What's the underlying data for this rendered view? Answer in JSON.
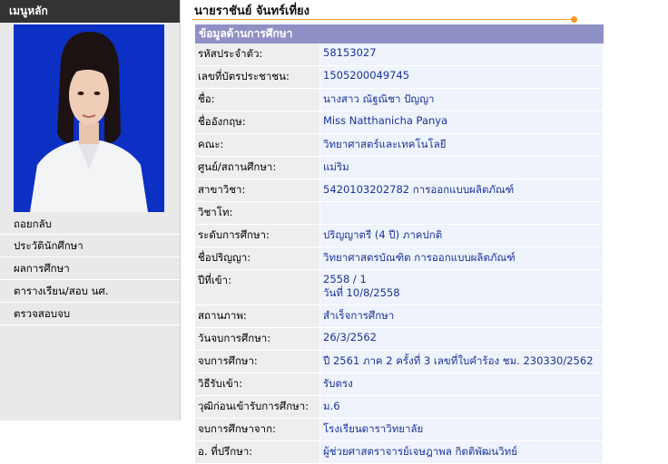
{
  "sidebar": {
    "header": "เมนูหลัก",
    "items": [
      {
        "label": "ถอยกลับ"
      },
      {
        "label": "ประวัตินักศึกษา"
      },
      {
        "label": "ผลการศึกษา"
      },
      {
        "label": "ตารางเรียน/สอบ นศ."
      },
      {
        "label": "ตรวจสอบจบ"
      }
    ]
  },
  "main": {
    "student_name": "นายราชันย์ จันทร์เที่ยง",
    "section_title": "ข้อมูลด้านการศึกษา",
    "rows": [
      {
        "label": "รหัสประจำตัว:",
        "value": "58153027"
      },
      {
        "label": "เลขที่บัตรประชาชน:",
        "value": "1505200049745"
      },
      {
        "label": "ชื่อ:",
        "value": "นางสาว ณัฐณิชา ปัญญา"
      },
      {
        "label": "ชื่ออังกฤษ:",
        "value": "Miss Natthanicha Panya"
      },
      {
        "label": "คณะ:",
        "value": "วิทยาศาสตร์และเทคโนโลยี"
      },
      {
        "label": "ศูนย์/สถานศึกษา:",
        "value": "แม่ริม"
      },
      {
        "label": "สาขาวิชา:",
        "value": "5420103202782 การออกแบบผลิตภัณฑ์"
      },
      {
        "label": "วิชาโท:",
        "value": ""
      },
      {
        "label": "ระดับการศึกษา:",
        "value": "ปริญญาตรี (4 ปี) ภาคปกติ"
      },
      {
        "label": "ชื่อปริญญา:",
        "value": "วิทยาศาสตรบัณฑิต การออกแบบผลิตภัณฑ์"
      },
      {
        "label": "ปีที่เข้า:",
        "value": "2558 / 1",
        "value2": "วันที่ 10/8/2558"
      },
      {
        "label": "สถานภาพ:",
        "value": "สำเร็จการศึกษา"
      },
      {
        "label": "วันจบการศึกษา:",
        "value": "26/3/2562"
      },
      {
        "label": "จบการศึกษา:",
        "value": "ปี 2561 ภาค 2 ครั้งที่ 3 เลขที่ใบคำร้อง ชม. 230330/2562"
      },
      {
        "label": "วิธีรับเข้า:",
        "value": "รับตรง"
      },
      {
        "label": "วุฒิก่อนเข้ารับการศึกษา:",
        "value": "ม.6"
      },
      {
        "label": "จบการศึกษาจาก:",
        "value": "โรงเรียนดาราวิทยาลัย"
      },
      {
        "label": "อ. ที่ปรึกษา:",
        "value": "ผู้ช่วยศาสตราจารย์เจษฎาพล กิตติพัฒนวิทย์"
      }
    ]
  },
  "colors": {
    "section_header": "#8f90c5",
    "accent_line": "#f29b1f",
    "value_text": "#1a3399",
    "sidebar_header": "#333333"
  }
}
